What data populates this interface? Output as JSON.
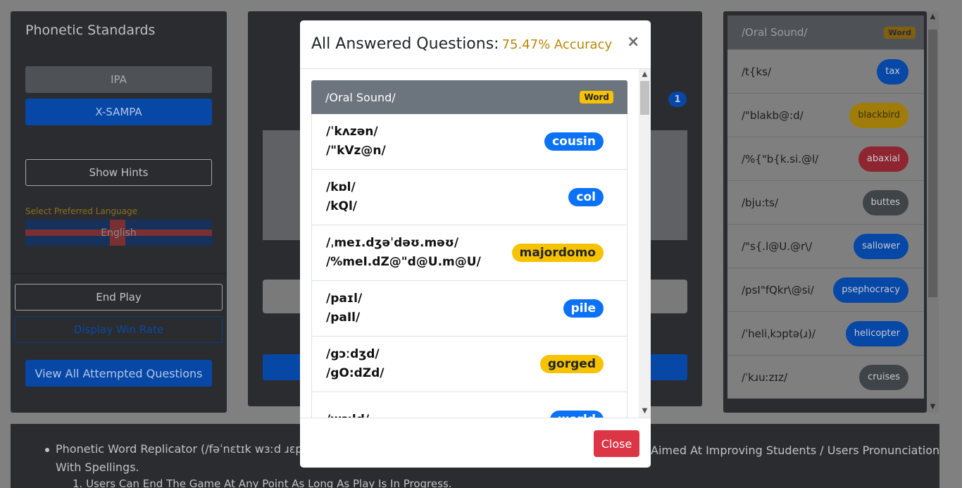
{
  "left_panel": {
    "title": "Phonetic Standards",
    "ipa_button": "IPA",
    "xsampa_button": "X-SAMPA",
    "hints_button": "Show Hints",
    "language_label": "Select Preferred Language",
    "language_value": "English",
    "end_button": "End Play",
    "winrate_button": "Display Win Rate",
    "view_all_button": "View All Attempted Questions"
  },
  "center_panel": {
    "badge": "1"
  },
  "right_panel": {
    "header": "/Oral Sound/",
    "header_badge": "Word",
    "rows": [
      {
        "sound": "/t{ks/",
        "word": "tax",
        "color": "blue"
      },
      {
        "sound": "/\"blakb@:d/",
        "word": "blackbird",
        "color": "yellow"
      },
      {
        "sound": "/%{\"b{k.si.@l/",
        "word": "abaxial",
        "color": "red"
      },
      {
        "sound": "/bju:ts/",
        "word": "buttes",
        "color": "gray"
      },
      {
        "sound": "/\"s{.l@U.@r\\/",
        "word": "sallower",
        "color": "blue"
      },
      {
        "sound": "/psI\"fQkr\\@si/",
        "word": "psephocracy",
        "color": "blue"
      },
      {
        "sound": "/ˈheliˌkɔptə(ɹ)/",
        "word": "helicopter",
        "color": "blue"
      },
      {
        "sound": "/ˈkɹuːzɪz/",
        "word": "cruises",
        "color": "gray"
      }
    ]
  },
  "footer": {
    "line1": "Phonetic Word Replicator (/fəˈnɛtɪk wɜːd ɹɛplɪ",
    "line1b": "Aimed At Improving Students / Users Pronunciation",
    "line2": "With Spellings.",
    "line3": "1. Users Can End The Game At Any Point As Long As Play Is In Progress."
  },
  "modal": {
    "title": "All Answered Questions:",
    "accuracy": "75.47% Accuracy",
    "close_x": "×",
    "list_header": "/Oral Sound/",
    "list_header_badge": "Word",
    "rows": [
      {
        "ipa": "/ˈkʌzən/",
        "xsampa": "/\"kVz@n/",
        "word": "cousin",
        "color": "blue"
      },
      {
        "ipa": "/kɒl/",
        "xsampa": "/kQl/",
        "word": "col",
        "color": "blue"
      },
      {
        "ipa": "/ˌmeɪ.dʒəˈdəʊ.məʊ/",
        "xsampa": "/%meI.dZ@\"d@U.m@U/",
        "word": "majordomo",
        "color": "yellow"
      },
      {
        "ipa": "/paɪl/",
        "xsampa": "/paIl/",
        "word": "pile",
        "color": "blue"
      },
      {
        "ipa": "/gɔːdʒd/",
        "xsampa": "/gO:dZd/",
        "word": "gorged",
        "color": "yellow"
      },
      {
        "ipa": "/wɜːld/",
        "xsampa": "",
        "word": "world",
        "color": "blue"
      }
    ],
    "close_button": "Close"
  }
}
